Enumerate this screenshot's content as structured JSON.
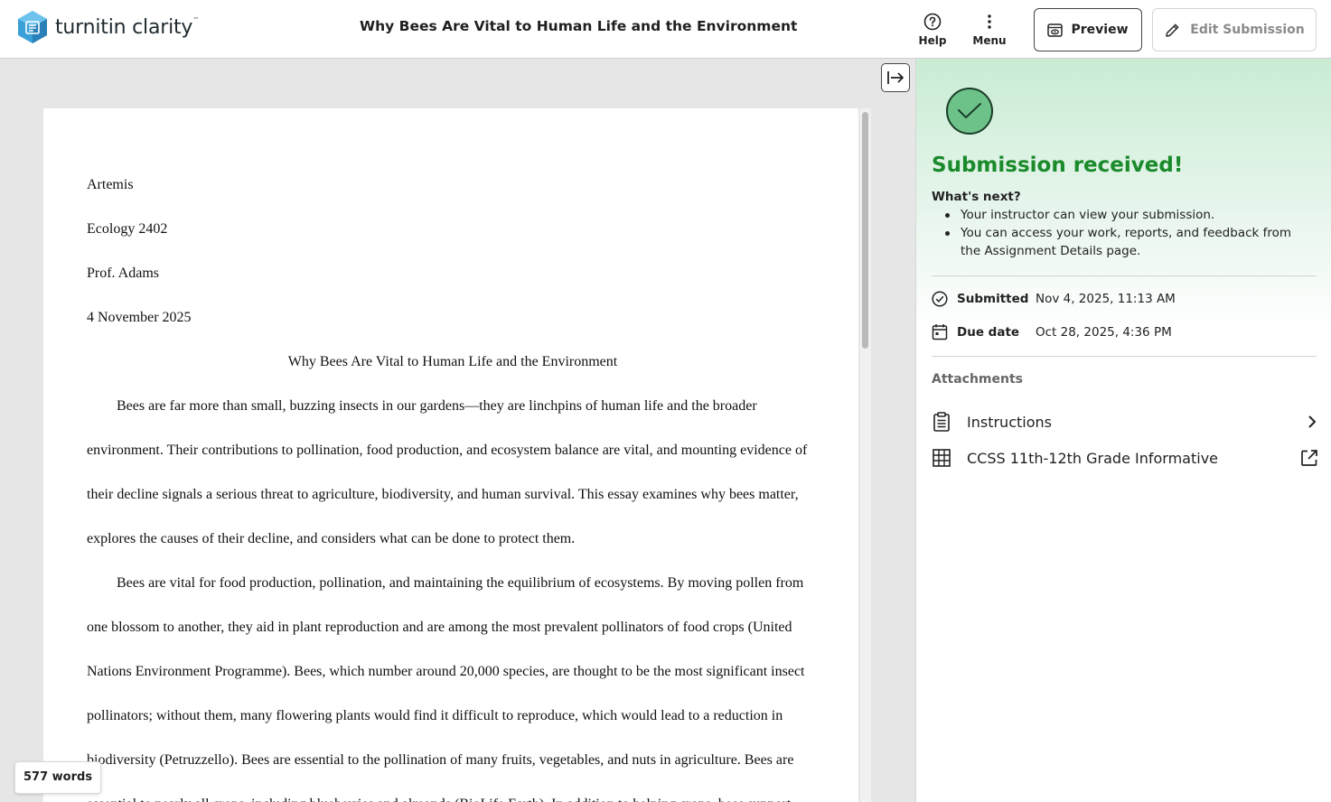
{
  "app": {
    "logo_text": "turnitin clarity",
    "logo_tm": "™",
    "document_title": "Why Bees Are Vital to Human Life and the Environment"
  },
  "toolbar": {
    "help_label": "Help",
    "menu_label": "Menu",
    "preview_label": "Preview",
    "edit_label": "Edit Submission"
  },
  "document": {
    "header_lines": [
      "Artemis",
      "Ecology 2402",
      "Prof. Adams",
      "4 November 2025"
    ],
    "title": "Why Bees Are Vital to Human Life and the Environment",
    "body_lines": [
      "Bees are far more than small, buzzing insects in our gardens—they are linchpins of human life and the broader",
      "environment. Their contributions to pollination, food production, and ecosystem balance are vital, and mounting evidence of",
      "their decline signals a serious threat to agriculture, biodiversity, and human survival. This essay examines why bees matter,",
      "explores the causes of their decline, and considers what can be done to protect them.",
      "Bees are vital for food production, pollination, and maintaining the equilibrium of ecosystems. By moving pollen from",
      "one blossom to another, they aid in plant reproduction and are among the most prevalent pollinators of food crops (United",
      "Nations Environment Programme). Bees, which number around 20,000 species, are thought to be the most significant insect",
      "pollinators; without them, many flowering plants would find it difficult to reproduce, which would lead to a reduction in",
      "biodiversity (Petruzzello). Bees are essential to the pollination of many fruits, vegetables, and nuts in agriculture. Bees are",
      "essential to nearly all crops, including blueberries and almonds (BioLife Earth). In addition to helping crops, bees support"
    ],
    "word_count": "577 words"
  },
  "panel": {
    "title": "Submission received!",
    "whats_next": "What's next?",
    "next_items": [
      "Your instructor can view your submission.",
      "You can access your work, reports, and feedback from the Assignment Details page."
    ],
    "submitted_label": "Submitted",
    "submitted_value": "Nov 4, 2025, 11:13 AM",
    "due_label": "Due date",
    "due_value": "Oct 28, 2025, 4:36 PM",
    "attachments_label": "Attachments",
    "attachments": [
      {
        "label": "Instructions",
        "icon": "clipboard-icon",
        "action": "chevron-right-icon"
      },
      {
        "label": "CCSS 11th-12th Grade Informative",
        "icon": "grid-icon",
        "action": "external-link-icon"
      }
    ]
  },
  "colors": {
    "success_green": "#1a8a2b",
    "check_fill": "#6dc28a",
    "panel_gradient_top": "#c9ecd3",
    "logo_teal": "#2f8fc6"
  }
}
